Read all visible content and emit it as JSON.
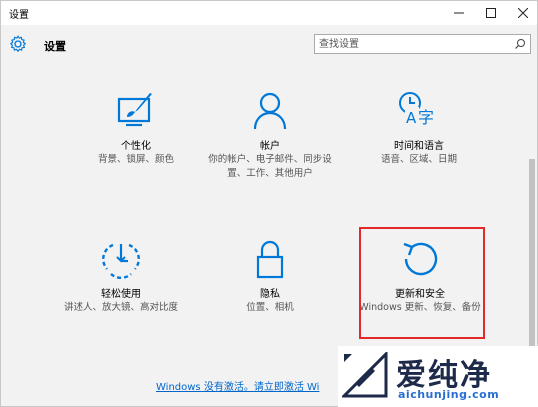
{
  "window": {
    "title": "设置"
  },
  "header": {
    "title": "设置",
    "search_placeholder": "查找设置"
  },
  "tiles": [
    {
      "title": "个性化",
      "desc": "背景、锁屏、颜色",
      "icon": "personalization-icon"
    },
    {
      "title": "帐户",
      "desc": "你的帐户、电子邮件、同步设置、工作、其他用户",
      "icon": "account-icon"
    },
    {
      "title": "时间和语言",
      "desc": "语音、区域、日期",
      "icon": "time-language-icon"
    },
    {
      "title": "轻松使用",
      "desc": "讲述人、放大镜、高对比度",
      "icon": "ease-of-access-icon"
    },
    {
      "title": "隐私",
      "desc": "位置、相机",
      "icon": "privacy-lock-icon"
    },
    {
      "title": "更新和安全",
      "desc": "Windows 更新、恢复、备份",
      "icon": "update-refresh-icon"
    }
  ],
  "footer": {
    "activate_text": "Windows 没有激活。请立即激活 Wi"
  },
  "watermark": {
    "brand": "爱纯净",
    "url": "aichunjing.com"
  },
  "colors": {
    "accent": "#0078d7",
    "highlight": "#e3282c"
  }
}
